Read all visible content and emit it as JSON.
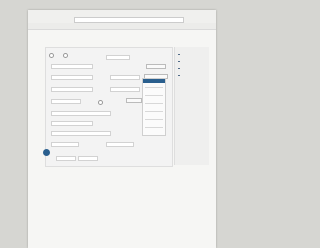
{
  "colors": {
    "paper": "#f6f6f4",
    "accent": "#2a5f8e",
    "panel_border": "#cfcfcf"
  },
  "icons": {
    "shell": "chevron-left-icon",
    "home": "home-icon",
    "close": "close-icon",
    "circle_button": "round-action-icon"
  },
  "browser": {
    "tab": "",
    "address": ""
  },
  "nav": {
    "back": "",
    "page": ""
  },
  "form": {
    "heading": "",
    "subheading": "",
    "sections": [],
    "fields": []
  },
  "side_menu": {
    "items": [
      "",
      "",
      "",
      ""
    ]
  },
  "footer_note": ""
}
